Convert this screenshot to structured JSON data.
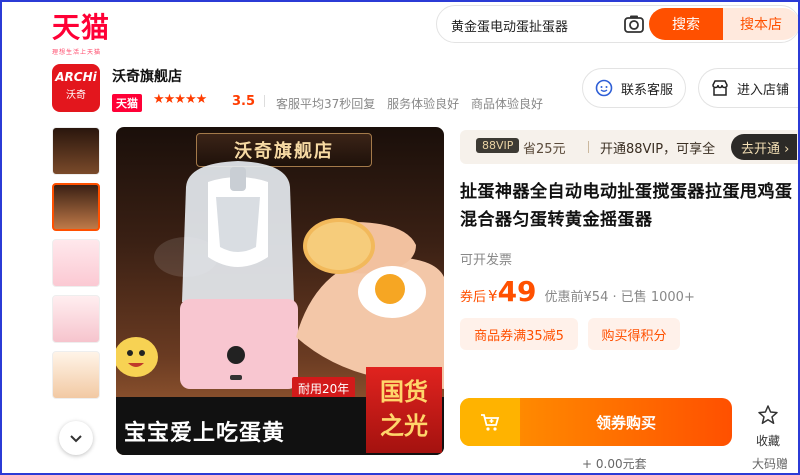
{
  "header": {
    "logo": "天猫",
    "logo_slogan": "理想生活上天猫",
    "search_value": "黄金蛋电动蛋扯蛋器",
    "search_button": "搜索",
    "search_local_button": "搜本店"
  },
  "shop": {
    "logo_line1": "ARCHi",
    "logo_line2": "沃奇",
    "name": "沃奇旗舰店",
    "badge": "天猫",
    "stars": "★★★★★",
    "rating": "3.5",
    "metrics": [
      "客服平均37秒回复",
      "服务体验良好",
      "商品体验良好"
    ],
    "contact_button": "联系客服",
    "enter_shop_button": "进入店铺"
  },
  "gallery": {
    "hero_shop_title": "沃奇旗舰店",
    "hero_caption": "宝宝爱上吃蛋黄",
    "durable_tag": "耐用20年",
    "guochao_line1": "国货",
    "guochao_line2": "之光"
  },
  "product": {
    "vip_badge": "88VIP",
    "vip_save": "省25元",
    "vip_text": "开通88VIP，可享全",
    "vip_open": "去开通 ›",
    "title": "扯蛋神器全自动电动扯蛋搅蛋器拉蛋甩鸡蛋混合器匀蛋转黄金摇蛋器",
    "invoice": "可开发票",
    "price_label": "券后",
    "price_currency": "¥",
    "price_value": "49",
    "price_original": "优惠前¥54 · 已售 1000+",
    "coupons": [
      "商品券满35减5",
      "购买得积分"
    ],
    "buy_button": "领券购买",
    "favorite": "收藏",
    "bottom_partial_left": "+ 0.00元套",
    "bottom_partial_right": "大码赠"
  },
  "colors": {
    "tmall_red": "#ff0036",
    "accent_orange": "#ff5000",
    "vip_dark": "#2c2a27"
  }
}
